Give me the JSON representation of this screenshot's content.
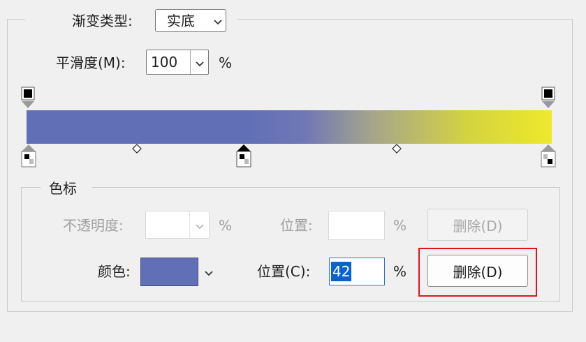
{
  "gradient_type": {
    "label": "渐变类型:",
    "value": "实底"
  },
  "smoothness": {
    "label": "平滑度(M):",
    "value": "100",
    "unit": "%"
  },
  "color_stop_section": {
    "title": "色标",
    "opacity_label": "不透明度:",
    "opacity_unit": "%",
    "opacity_location_label": "位置:",
    "opacity_location_unit": "%",
    "opacity_delete_label": "删除(D)",
    "color_label": "颜色:",
    "color_swatch": "#6170b6",
    "color_location_label": "位置(C):",
    "color_location_value": "42",
    "color_location_unit": "%",
    "color_delete_label": "删除(D)"
  },
  "gradient": {
    "start_color": "#6170b6",
    "end_color": "#ede92c",
    "color_stops_percent": [
      0,
      42,
      100
    ],
    "opacity_stops_percent": [
      0,
      100
    ],
    "midpoints_percent": [
      21,
      71
    ]
  },
  "colors": {
    "highlight_border": "#e0141e",
    "selection": "#0a64c8"
  },
  "icons": [
    "chevron-down-icon",
    "opacity-stop-icon",
    "color-stop-icon",
    "midpoint-diamond-icon"
  ]
}
